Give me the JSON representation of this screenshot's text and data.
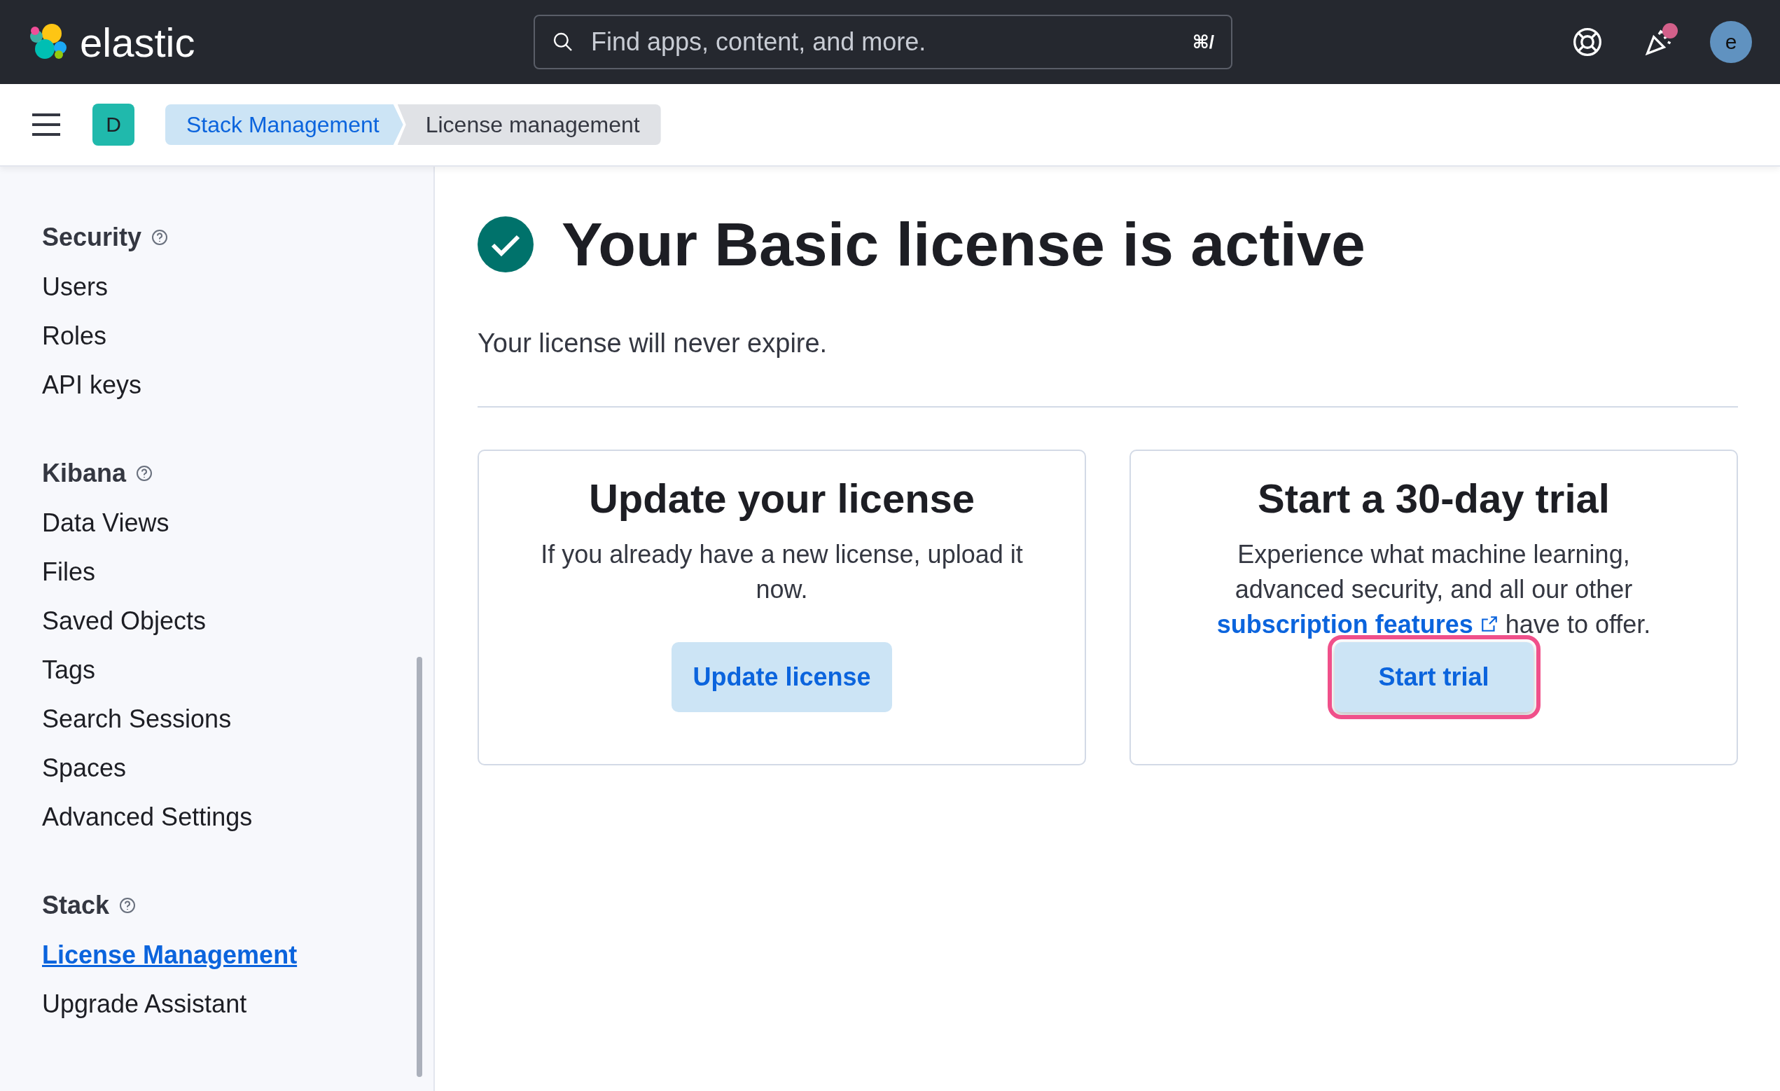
{
  "header": {
    "logo_text": "elastic",
    "search": {
      "placeholder": "Find apps, content, and more.",
      "shortcut": "⌘/"
    },
    "notification_unread": true,
    "avatar": "e"
  },
  "breadcrumb_bar": {
    "space": "D",
    "crumbs": [
      {
        "label": "Stack Management",
        "selected": false
      },
      {
        "label": "License management",
        "selected": true
      }
    ]
  },
  "sidebar": {
    "groups": [
      {
        "title": "Security",
        "items": [
          {
            "label": "Users",
            "selected": false
          },
          {
            "label": "Roles",
            "selected": false
          },
          {
            "label": "API keys",
            "selected": false
          }
        ]
      },
      {
        "title": "Kibana",
        "items": [
          {
            "label": "Data Views",
            "selected": false
          },
          {
            "label": "Files",
            "selected": false
          },
          {
            "label": "Saved Objects",
            "selected": false
          },
          {
            "label": "Tags",
            "selected": false
          },
          {
            "label": "Search Sessions",
            "selected": false
          },
          {
            "label": "Spaces",
            "selected": false
          },
          {
            "label": "Advanced Settings",
            "selected": false
          }
        ]
      },
      {
        "title": "Stack",
        "items": [
          {
            "label": "License Management",
            "selected": true
          },
          {
            "label": "Upgrade Assistant",
            "selected": false
          }
        ]
      }
    ]
  },
  "main": {
    "title": "Your Basic license is active",
    "subtitle": "Your license will never expire.",
    "cards": [
      {
        "title": "Update your license",
        "description": "If you already have a new license, upload it now.",
        "button": {
          "label": "Update license",
          "highlighted": false
        }
      },
      {
        "title": "Start a 30-day trial",
        "description": "Experience what machine learning, advanced security, and all our other",
        "link": "subscription features",
        "description_end": "have to offer.",
        "button": {
          "label": "Start trial",
          "highlighted": true
        }
      }
    ]
  }
}
